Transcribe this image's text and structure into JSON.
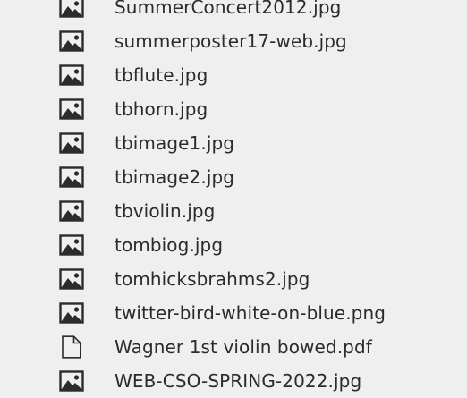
{
  "files": [
    {
      "name": "SummerConcert2012.jpg",
      "icon": "image-file-icon"
    },
    {
      "name": "summerposter17-web.jpg",
      "icon": "image-file-icon"
    },
    {
      "name": "tbflute.jpg",
      "icon": "image-file-icon"
    },
    {
      "name": "tbhorn.jpg",
      "icon": "image-file-icon"
    },
    {
      "name": "tbimage1.jpg",
      "icon": "image-file-icon"
    },
    {
      "name": "tbimage2.jpg",
      "icon": "image-file-icon"
    },
    {
      "name": "tbviolin.jpg",
      "icon": "image-file-icon"
    },
    {
      "name": "tombiog.jpg",
      "icon": "image-file-icon"
    },
    {
      "name": "tomhicksbrahms2.jpg",
      "icon": "image-file-icon"
    },
    {
      "name": "twitter-bird-white-on-blue.png",
      "icon": "image-file-icon"
    },
    {
      "name": "Wagner 1st violin bowed.pdf",
      "icon": "document-file-icon"
    },
    {
      "name": "WEB-CSO-SPRING-2022.jpg",
      "icon": "image-file-icon"
    }
  ],
  "colors": {
    "background": "#efefef",
    "text": "#2b2b2b",
    "icon": "#2b2b2b"
  }
}
